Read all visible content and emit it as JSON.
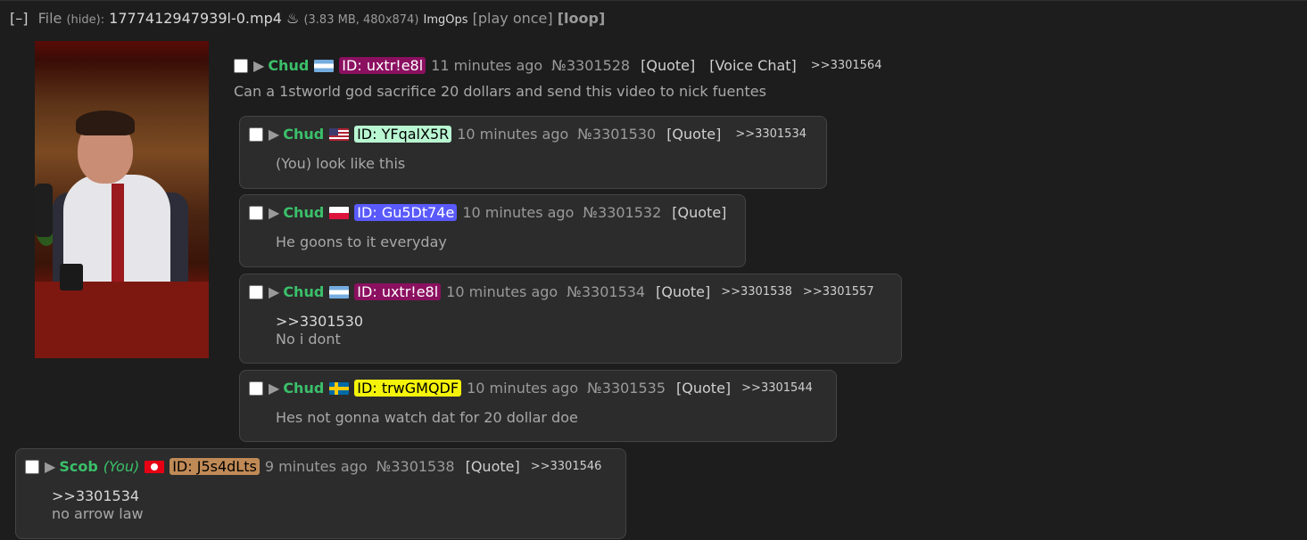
{
  "filebar": {
    "toggle": "[–]",
    "file_label": "File",
    "hide": "(hide):",
    "filename": "1777412947939l-0.mp4",
    "wh_icon": "♨",
    "info": "(3.83 MB, 480x874)",
    "imgops": "ImgOps",
    "play_once": "[play once]",
    "loop": "[loop]"
  },
  "op": {
    "name": "Chud",
    "id": "ID: uxtr!e8l",
    "time": "11 minutes ago",
    "num": "№3301528",
    "quote": "[Quote]",
    "voice": "[Voice Chat]",
    "backlinks": [
      ">>3301564"
    ],
    "text": "Can a 1stworld god sacrifice 20 dollars and send this video to nick fuentes",
    "colors": {
      "id_bg": "#8b1060",
      "id_fg": "#ffffff"
    }
  },
  "replies": [
    {
      "name": "Chud",
      "id": "ID: YFqalX5R",
      "time": "10 minutes ago",
      "num": "№3301530",
      "quote": "[Quote]",
      "backlinks": [
        ">>3301534"
      ],
      "quote_line": "",
      "text": "(You) look like this",
      "id_bg": "#b9f6d2",
      "id_fg": "#000000",
      "flag": "us"
    },
    {
      "name": "Chud",
      "id": "ID: Gu5Dt74e",
      "time": "10 minutes ago",
      "num": "№3301532",
      "quote": "[Quote]",
      "backlinks": [],
      "quote_line": "",
      "text": "He goons to it everyday",
      "id_bg": "#5a5afc",
      "id_fg": "#ffffff",
      "flag": "pl"
    },
    {
      "name": "Chud",
      "id": "ID: uxtr!e8l",
      "time": "10 minutes ago",
      "num": "№3301534",
      "quote": "[Quote]",
      "backlinks": [
        ">>3301538",
        ">>3301557"
      ],
      "quote_line": ">>3301530",
      "text": "No i dont",
      "id_bg": "#8b1060",
      "id_fg": "#ffffff",
      "flag": "ar"
    },
    {
      "name": "Chud",
      "id": "ID: trwGMQDF",
      "time": "10 minutes ago",
      "num": "№3301535",
      "quote": "[Quote]",
      "backlinks": [
        ">>3301544"
      ],
      "quote_line": "",
      "text": "Hes not gonna watch dat for 20 dollar doe",
      "id_bg": "#f4f40a",
      "id_fg": "#000000",
      "flag": "se"
    }
  ],
  "you_post": {
    "name": "Scob",
    "you": "(You)",
    "id": "ID: J5s4dLts",
    "time": "9 minutes ago",
    "num": "№3301538",
    "quote": "[Quote]",
    "backlinks": [
      ">>3301546"
    ],
    "quote_line": ">>3301534",
    "text": "no arrow law",
    "id_bg": "#c08a56",
    "id_fg": "#000000",
    "flag": "tn"
  }
}
